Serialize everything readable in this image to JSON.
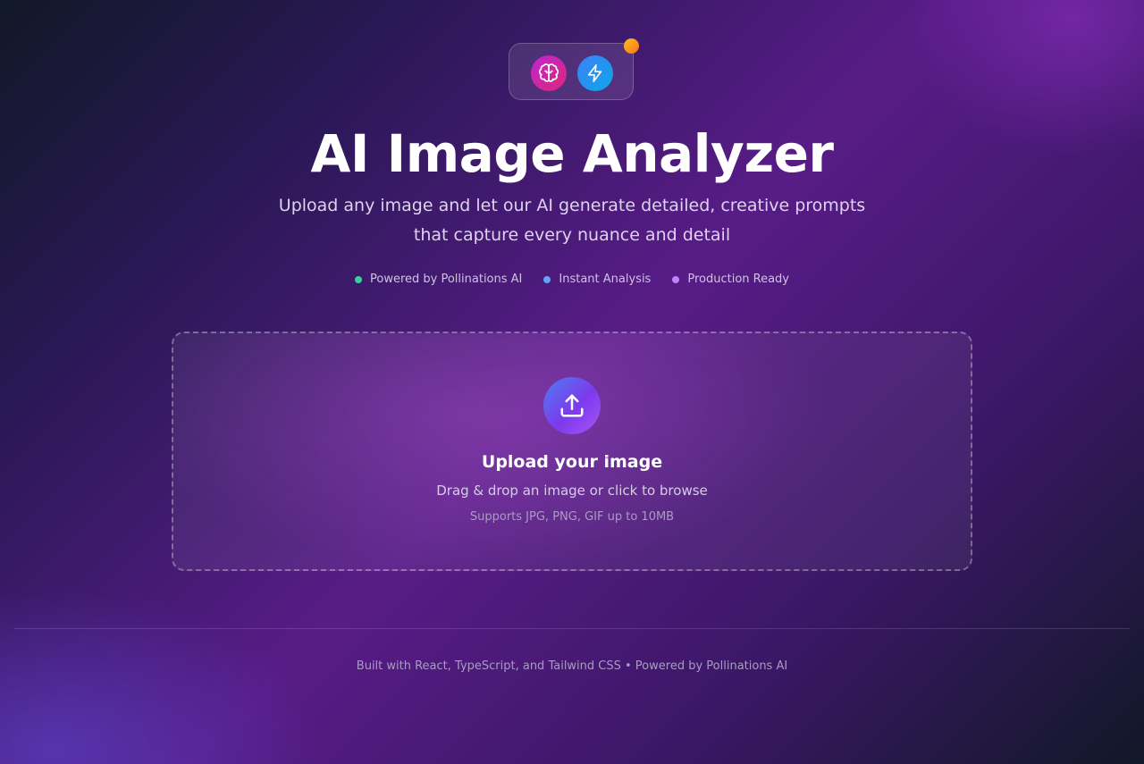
{
  "header": {
    "icons": [
      "brain-icon",
      "lightning-bolt-icon"
    ],
    "title": "AI Image Analyzer",
    "subtitle": "Upload any image and let our AI generate detailed, creative prompts that capture every nuance and detail",
    "features": [
      {
        "label": "Powered by Pollinations AI",
        "color": "#34d399"
      },
      {
        "label": "Instant Analysis",
        "color": "#60a5fa"
      },
      {
        "label": "Production Ready",
        "color": "#c084fc"
      }
    ]
  },
  "upload": {
    "icon": "upload-icon",
    "title": "Upload your image",
    "instructions": "Drag & drop an image or click to browse",
    "supported_formats": "Supports JPG, PNG, GIF up to 10MB"
  },
  "footer": {
    "text": "Built with React, TypeScript, and Tailwind CSS • Powered by Pollinations AI"
  },
  "colors": {
    "accent_orange": "#f59e0b",
    "brain_gradient": [
      "#c026d3",
      "#db2777"
    ],
    "bolt_gradient": [
      "#3b82f6",
      "#0ea5e9"
    ],
    "upload_gradient": [
      "#4f7df0",
      "#a855f7"
    ]
  }
}
